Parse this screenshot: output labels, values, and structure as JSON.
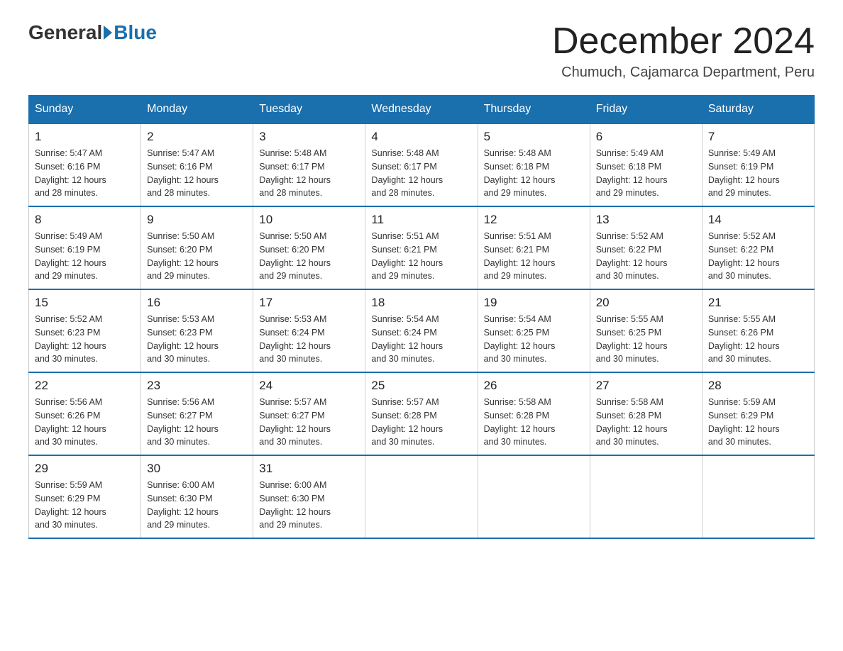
{
  "logo": {
    "general": "General",
    "blue": "Blue"
  },
  "header": {
    "month_year": "December 2024",
    "location": "Chumuch, Cajamarca Department, Peru"
  },
  "days_of_week": [
    "Sunday",
    "Monday",
    "Tuesday",
    "Wednesday",
    "Thursday",
    "Friday",
    "Saturday"
  ],
  "weeks": [
    [
      {
        "day": "1",
        "sunrise": "5:47 AM",
        "sunset": "6:16 PM",
        "daylight": "12 hours and 28 minutes."
      },
      {
        "day": "2",
        "sunrise": "5:47 AM",
        "sunset": "6:16 PM",
        "daylight": "12 hours and 28 minutes."
      },
      {
        "day": "3",
        "sunrise": "5:48 AM",
        "sunset": "6:17 PM",
        "daylight": "12 hours and 28 minutes."
      },
      {
        "day": "4",
        "sunrise": "5:48 AM",
        "sunset": "6:17 PM",
        "daylight": "12 hours and 28 minutes."
      },
      {
        "day": "5",
        "sunrise": "5:48 AM",
        "sunset": "6:18 PM",
        "daylight": "12 hours and 29 minutes."
      },
      {
        "day": "6",
        "sunrise": "5:49 AM",
        "sunset": "6:18 PM",
        "daylight": "12 hours and 29 minutes."
      },
      {
        "day": "7",
        "sunrise": "5:49 AM",
        "sunset": "6:19 PM",
        "daylight": "12 hours and 29 minutes."
      }
    ],
    [
      {
        "day": "8",
        "sunrise": "5:49 AM",
        "sunset": "6:19 PM",
        "daylight": "12 hours and 29 minutes."
      },
      {
        "day": "9",
        "sunrise": "5:50 AM",
        "sunset": "6:20 PM",
        "daylight": "12 hours and 29 minutes."
      },
      {
        "day": "10",
        "sunrise": "5:50 AM",
        "sunset": "6:20 PM",
        "daylight": "12 hours and 29 minutes."
      },
      {
        "day": "11",
        "sunrise": "5:51 AM",
        "sunset": "6:21 PM",
        "daylight": "12 hours and 29 minutes."
      },
      {
        "day": "12",
        "sunrise": "5:51 AM",
        "sunset": "6:21 PM",
        "daylight": "12 hours and 29 minutes."
      },
      {
        "day": "13",
        "sunrise": "5:52 AM",
        "sunset": "6:22 PM",
        "daylight": "12 hours and 30 minutes."
      },
      {
        "day": "14",
        "sunrise": "5:52 AM",
        "sunset": "6:22 PM",
        "daylight": "12 hours and 30 minutes."
      }
    ],
    [
      {
        "day": "15",
        "sunrise": "5:52 AM",
        "sunset": "6:23 PM",
        "daylight": "12 hours and 30 minutes."
      },
      {
        "day": "16",
        "sunrise": "5:53 AM",
        "sunset": "6:23 PM",
        "daylight": "12 hours and 30 minutes."
      },
      {
        "day": "17",
        "sunrise": "5:53 AM",
        "sunset": "6:24 PM",
        "daylight": "12 hours and 30 minutes."
      },
      {
        "day": "18",
        "sunrise": "5:54 AM",
        "sunset": "6:24 PM",
        "daylight": "12 hours and 30 minutes."
      },
      {
        "day": "19",
        "sunrise": "5:54 AM",
        "sunset": "6:25 PM",
        "daylight": "12 hours and 30 minutes."
      },
      {
        "day": "20",
        "sunrise": "5:55 AM",
        "sunset": "6:25 PM",
        "daylight": "12 hours and 30 minutes."
      },
      {
        "day": "21",
        "sunrise": "5:55 AM",
        "sunset": "6:26 PM",
        "daylight": "12 hours and 30 minutes."
      }
    ],
    [
      {
        "day": "22",
        "sunrise": "5:56 AM",
        "sunset": "6:26 PM",
        "daylight": "12 hours and 30 minutes."
      },
      {
        "day": "23",
        "sunrise": "5:56 AM",
        "sunset": "6:27 PM",
        "daylight": "12 hours and 30 minutes."
      },
      {
        "day": "24",
        "sunrise": "5:57 AM",
        "sunset": "6:27 PM",
        "daylight": "12 hours and 30 minutes."
      },
      {
        "day": "25",
        "sunrise": "5:57 AM",
        "sunset": "6:28 PM",
        "daylight": "12 hours and 30 minutes."
      },
      {
        "day": "26",
        "sunrise": "5:58 AM",
        "sunset": "6:28 PM",
        "daylight": "12 hours and 30 minutes."
      },
      {
        "day": "27",
        "sunrise": "5:58 AM",
        "sunset": "6:28 PM",
        "daylight": "12 hours and 30 minutes."
      },
      {
        "day": "28",
        "sunrise": "5:59 AM",
        "sunset": "6:29 PM",
        "daylight": "12 hours and 30 minutes."
      }
    ],
    [
      {
        "day": "29",
        "sunrise": "5:59 AM",
        "sunset": "6:29 PM",
        "daylight": "12 hours and 30 minutes."
      },
      {
        "day": "30",
        "sunrise": "6:00 AM",
        "sunset": "6:30 PM",
        "daylight": "12 hours and 29 minutes."
      },
      {
        "day": "31",
        "sunrise": "6:00 AM",
        "sunset": "6:30 PM",
        "daylight": "12 hours and 29 minutes."
      },
      null,
      null,
      null,
      null
    ]
  ],
  "labels": {
    "sunrise": "Sunrise:",
    "sunset": "Sunset:",
    "daylight": "Daylight:"
  }
}
